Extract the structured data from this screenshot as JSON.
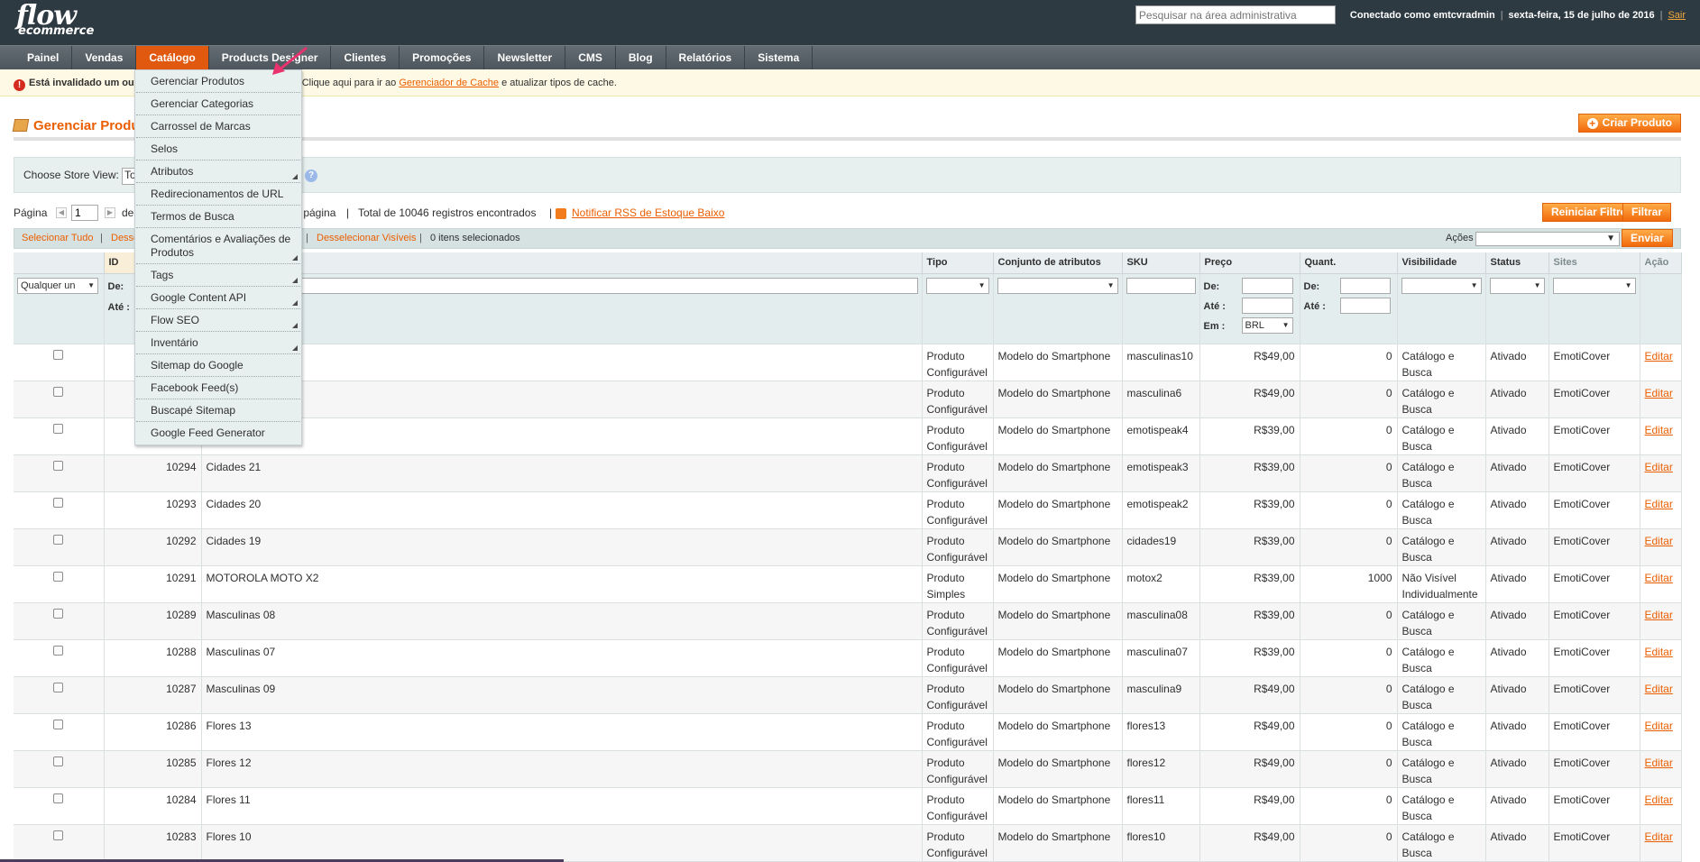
{
  "header": {
    "logo_main": "flow",
    "logo_sub": "ecommerce",
    "search_placeholder": "Pesquisar na área administrativa",
    "logged_in": "Conectado como emtcvradmin",
    "date": "sexta-feira, 15 de julho de 2016",
    "logout": "Sair"
  },
  "nav": {
    "items": [
      "Painel",
      "Vendas",
      "Catálogo",
      "Products Designer",
      "Clientes",
      "Promoções",
      "Newsletter",
      "CMS",
      "Blog",
      "Relatórios",
      "Sistema"
    ],
    "active": "Catálogo"
  },
  "message": {
    "part1": "Está invalidado um ou",
    "part2": "output. Clique aqui para ir ao",
    "link": "Gerenciador de Cache",
    "part3": "e atualizar tipos de cache."
  },
  "dropdown": {
    "items": [
      {
        "label": "Gerenciar Produtos",
        "sub": false
      },
      {
        "label": "Gerenciar Categorias",
        "sub": false
      },
      {
        "label": "Carrossel de Marcas",
        "sub": false
      },
      {
        "label": "Selos",
        "sub": false
      },
      {
        "label": "Atributos",
        "sub": true
      },
      {
        "label": "Redirecionamentos de URL",
        "sub": false
      },
      {
        "label": "Termos de Busca",
        "sub": false
      },
      {
        "label": "Comentários e Avaliações de Produtos",
        "sub": true
      },
      {
        "label": "Tags",
        "sub": true
      },
      {
        "label": "Google Content API",
        "sub": true
      },
      {
        "label": "Flow SEO",
        "sub": true
      },
      {
        "label": "Inventário",
        "sub": true
      },
      {
        "label": "Sitemap do Google",
        "sub": false
      },
      {
        "label": "Facebook Feed(s)",
        "sub": false
      },
      {
        "label": "Buscapé Sitemap",
        "sub": false
      },
      {
        "label": "Google Feed Generator",
        "sub": false
      }
    ]
  },
  "page": {
    "title": "Gerenciar Produ",
    "create_button": "Criar Produto",
    "store_view_label": "Choose Store View:",
    "store_view_value": "To"
  },
  "pager": {
    "label": "Página",
    "page": "1",
    "of_text": "de",
    "per_page_text": "r página",
    "sep": "|",
    "total": "Total de 10046 registros encontrados",
    "rss_link": "Notificar RSS de Estoque Baixo",
    "reset_filter": "Reiniciar Filtro",
    "filter": "Filtrar"
  },
  "massaction": {
    "select_all": "Selecionar Tudo",
    "deselect_all": "Desse",
    "deselect_visible": "Desselecionar Visíveis",
    "selected_count": "0 itens selecionados",
    "actions_label": "Ações",
    "submit": "Enviar",
    "sep": "|"
  },
  "grid": {
    "columns": {
      "id": "ID",
      "type": "Tipo",
      "attr_set": "Conjunto de atributos",
      "sku": "SKU",
      "price": "Preço",
      "qty": "Quant.",
      "visibility": "Visibilidade",
      "status": "Status",
      "sites": "Sites",
      "action": "Ação"
    },
    "filters": {
      "any": "Qualquer un",
      "from": "De:",
      "to": "Até :",
      "in": "Em :",
      "currency": "BRL"
    },
    "rows": [
      {
        "id": "",
        "name": "",
        "type": "Produto Configurável",
        "attr": "Modelo do Smartphone",
        "sku": "masculinas10",
        "price": "R$49,00",
        "qty": "0",
        "vis": "Catálogo e Busca",
        "status": "Ativado",
        "site": "EmotiCover",
        "edit": "Editar"
      },
      {
        "id": "",
        "name": "",
        "type": "Produto Configurável",
        "attr": "Modelo do Smartphone",
        "sku": "masculina6",
        "price": "R$49,00",
        "qty": "0",
        "vis": "Catálogo e Busca",
        "status": "Ativado",
        "site": "EmotiCover",
        "edit": "Editar"
      },
      {
        "id": "",
        "name": "",
        "type": "Produto Configurável",
        "attr": "Modelo do Smartphone",
        "sku": "emotispeak4",
        "price": "R$39,00",
        "qty": "0",
        "vis": "Catálogo e Busca",
        "status": "Ativado",
        "site": "EmotiCover",
        "edit": "Editar"
      },
      {
        "id": "10294",
        "name": "Cidades 21",
        "type": "Produto Configurável",
        "attr": "Modelo do Smartphone",
        "sku": "emotispeak3",
        "price": "R$39,00",
        "qty": "0",
        "vis": "Catálogo e Busca",
        "status": "Ativado",
        "site": "EmotiCover",
        "edit": "Editar"
      },
      {
        "id": "10293",
        "name": "Cidades 20",
        "type": "Produto Configurável",
        "attr": "Modelo do Smartphone",
        "sku": "emotispeak2",
        "price": "R$39,00",
        "qty": "0",
        "vis": "Catálogo e Busca",
        "status": "Ativado",
        "site": "EmotiCover",
        "edit": "Editar"
      },
      {
        "id": "10292",
        "name": "Cidades 19",
        "type": "Produto Configurável",
        "attr": "Modelo do Smartphone",
        "sku": "cidades19",
        "price": "R$39,00",
        "qty": "0",
        "vis": "Catálogo e Busca",
        "status": "Ativado",
        "site": "EmotiCover",
        "edit": "Editar"
      },
      {
        "id": "10291",
        "name": "MOTOROLA MOTO X2",
        "type": "Produto Simples",
        "attr": "Modelo do Smartphone",
        "sku": "motox2",
        "price": "R$39,00",
        "qty": "1000",
        "vis": "Não Visível Individualmente",
        "status": "Ativado",
        "site": "EmotiCover",
        "edit": "Editar"
      },
      {
        "id": "10289",
        "name": "Masculinas 08",
        "type": "Produto Configurável",
        "attr": "Modelo do Smartphone",
        "sku": "masculina08",
        "price": "R$39,00",
        "qty": "0",
        "vis": "Catálogo e Busca",
        "status": "Ativado",
        "site": "EmotiCover",
        "edit": "Editar"
      },
      {
        "id": "10288",
        "name": "Masculinas 07",
        "type": "Produto Configurável",
        "attr": "Modelo do Smartphone",
        "sku": "masculina07",
        "price": "R$39,00",
        "qty": "0",
        "vis": "Catálogo e Busca",
        "status": "Ativado",
        "site": "EmotiCover",
        "edit": "Editar"
      },
      {
        "id": "10287",
        "name": "Masculinas 09",
        "type": "Produto Configurável",
        "attr": "Modelo do Smartphone",
        "sku": "masculina9",
        "price": "R$49,00",
        "qty": "0",
        "vis": "Catálogo e Busca",
        "status": "Ativado",
        "site": "EmotiCover",
        "edit": "Editar"
      },
      {
        "id": "10286",
        "name": "Flores 13",
        "type": "Produto Configurável",
        "attr": "Modelo do Smartphone",
        "sku": "flores13",
        "price": "R$49,00",
        "qty": "0",
        "vis": "Catálogo e Busca",
        "status": "Ativado",
        "site": "EmotiCover",
        "edit": "Editar"
      },
      {
        "id": "10285",
        "name": "Flores 12",
        "type": "Produto Configurável",
        "attr": "Modelo do Smartphone",
        "sku": "flores12",
        "price": "R$49,00",
        "qty": "0",
        "vis": "Catálogo e Busca",
        "status": "Ativado",
        "site": "EmotiCover",
        "edit": "Editar"
      },
      {
        "id": "10284",
        "name": "Flores 11",
        "type": "Produto Configurável",
        "attr": "Modelo do Smartphone",
        "sku": "flores11",
        "price": "R$49,00",
        "qty": "0",
        "vis": "Catálogo e Busca",
        "status": "Ativado",
        "site": "EmotiCover",
        "edit": "Editar"
      },
      {
        "id": "10283",
        "name": "Flores 10",
        "type": "Produto Configurável",
        "attr": "Modelo do Smartphone",
        "sku": "flores10",
        "price": "R$49,00",
        "qty": "0",
        "vis": "Catálogo e Busca",
        "status": "Ativado",
        "site": "EmotiCover",
        "edit": "Editar"
      }
    ]
  },
  "colors": {
    "accent": "#eb5e00",
    "header_bg": "#2d3a42",
    "nav_active": "#e0590f",
    "arrow": "#e8336e"
  }
}
